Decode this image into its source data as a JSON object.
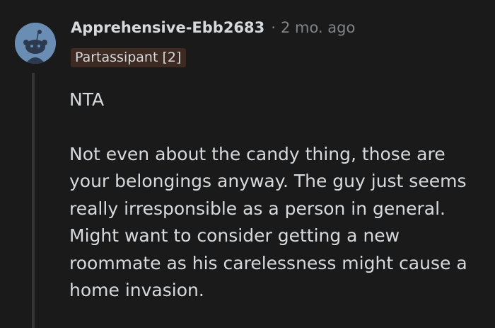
{
  "comment": {
    "author": "Apprehensive-Ebb2683",
    "separator": "·",
    "timestamp": "2 mo. ago",
    "flair": "Partassipant [2]",
    "avatar_icon": "snoo-avatar-icon",
    "paragraphs": [
      "NTA",
      "Not even about the candy thing, those are your belongings anyway. The guy just seems really irresponsible as a person in general. Might want to consider getting a new roommate as his carelessness might cause a home invasion."
    ]
  },
  "colors": {
    "background": "#1a1a1b",
    "text": "#d7dadc",
    "muted": "#818384",
    "flair_bg": "#3d2a22",
    "avatar_bg": "#6a8db4",
    "thread_line": "#343536"
  }
}
